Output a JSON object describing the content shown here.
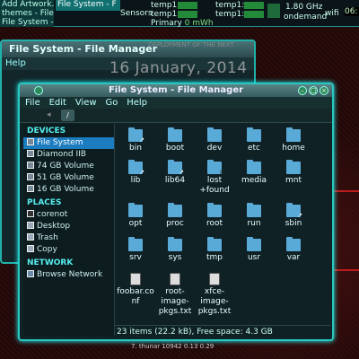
{
  "panel": {
    "tasks": [
      "Add Artwork...",
      "themes - File...",
      "File System - F..."
    ],
    "active_task": "File System - F",
    "sensors_label": "Sensors",
    "temp1_a": "temp1:",
    "temp1_b": "temp1:",
    "temp1_c": "temp1:",
    "temp1_d": "temp1:",
    "primary": "Primary",
    "power": "0 mWh",
    "cpu_freq": "1.80 GHz",
    "governor": "ondemand",
    "wifi": "wifi",
    "clock": "06:"
  },
  "bg_window": {
    "title": "File System - File Manager",
    "menu_help": "Help",
    "date": "16 January, 2014",
    "date_small": "DEPLOYMENT OF THE NEXT"
  },
  "window": {
    "title": "File System - File Manager",
    "menu": [
      "File",
      "Edit",
      "View",
      "Go",
      "Help"
    ],
    "path_btn": "/",
    "sidebar": {
      "devices_head": "DEVICES",
      "devices": [
        "File System",
        "Diamond IIB",
        "74 GB Volume",
        "51 GB Volume",
        "16 GB Volume"
      ],
      "places_head": "PLACES",
      "places": [
        "corenot",
        "Desktop",
        "Trash",
        "Copy"
      ],
      "network_head": "NETWORK",
      "network": [
        "Browse Network"
      ]
    },
    "files": [
      {
        "name": "bin",
        "type": "folder-link"
      },
      {
        "name": "boot",
        "type": "folder"
      },
      {
        "name": "dev",
        "type": "folder"
      },
      {
        "name": "etc",
        "type": "folder"
      },
      {
        "name": "home",
        "type": "folder"
      },
      {
        "name": "lib",
        "type": "folder-link"
      },
      {
        "name": "lib64",
        "type": "folder-link"
      },
      {
        "name": "lost\n+found",
        "type": "folder-locked"
      },
      {
        "name": "media",
        "type": "folder"
      },
      {
        "name": "mnt",
        "type": "folder"
      },
      {
        "name": "opt",
        "type": "folder"
      },
      {
        "name": "proc",
        "type": "folder"
      },
      {
        "name": "root",
        "type": "folder"
      },
      {
        "name": "run",
        "type": "folder"
      },
      {
        "name": "sbin",
        "type": "folder-link"
      },
      {
        "name": "srv",
        "type": "folder"
      },
      {
        "name": "sys",
        "type": "folder"
      },
      {
        "name": "tmp",
        "type": "folder"
      },
      {
        "name": "usr",
        "type": "folder"
      },
      {
        "name": "var",
        "type": "folder"
      },
      {
        "name": "foobar.co\nnf",
        "type": "doc"
      },
      {
        "name": "root-\nimage-\npkgs.txt",
        "type": "doc"
      },
      {
        "name": "xfce-\nimage-\npkgs.txt",
        "type": "doc"
      }
    ],
    "status": "23 items (22.2 kB), Free space: 4.3 GB"
  },
  "bottom": "7.  thunar     10942  0.13   0.29",
  "colors": {
    "accent": "#28c8c0",
    "selection": "#1c7cc0",
    "folder": "#5aaad8"
  }
}
